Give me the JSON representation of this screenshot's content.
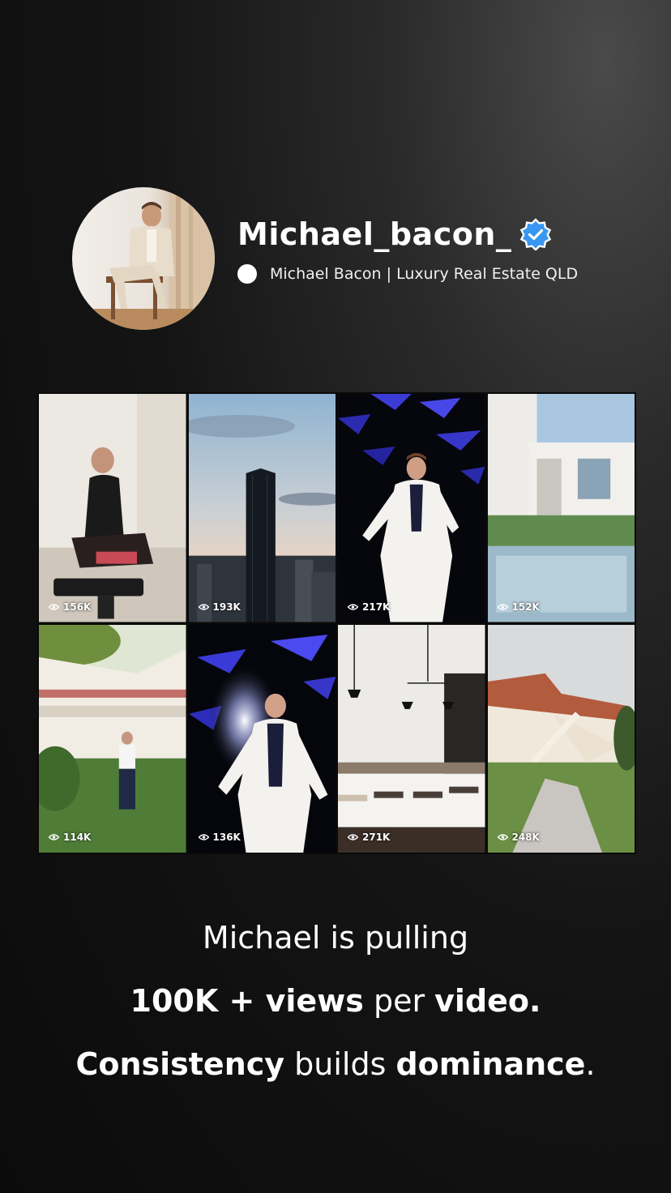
{
  "profile": {
    "username": "Michael_bacon_",
    "bio": "Michael Bacon | Luxury Real Estate QLD",
    "verified_color": "#3897f0"
  },
  "videos": [
    {
      "views": "156K"
    },
    {
      "views": "193K"
    },
    {
      "views": "217K"
    },
    {
      "views": "152K"
    },
    {
      "views": "114K"
    },
    {
      "views": "136K"
    },
    {
      "views": "271K"
    },
    {
      "views": "248K"
    }
  ],
  "caption": {
    "line1": "Michael is pulling",
    "line2_bold_a": "100K + views",
    "line2_plain": " per ",
    "line2_bold_b": "video.",
    "line3_bold_a": "Consistency",
    "line3_plain": " builds ",
    "line3_bold_b": "dominance",
    "line3_end": "."
  }
}
